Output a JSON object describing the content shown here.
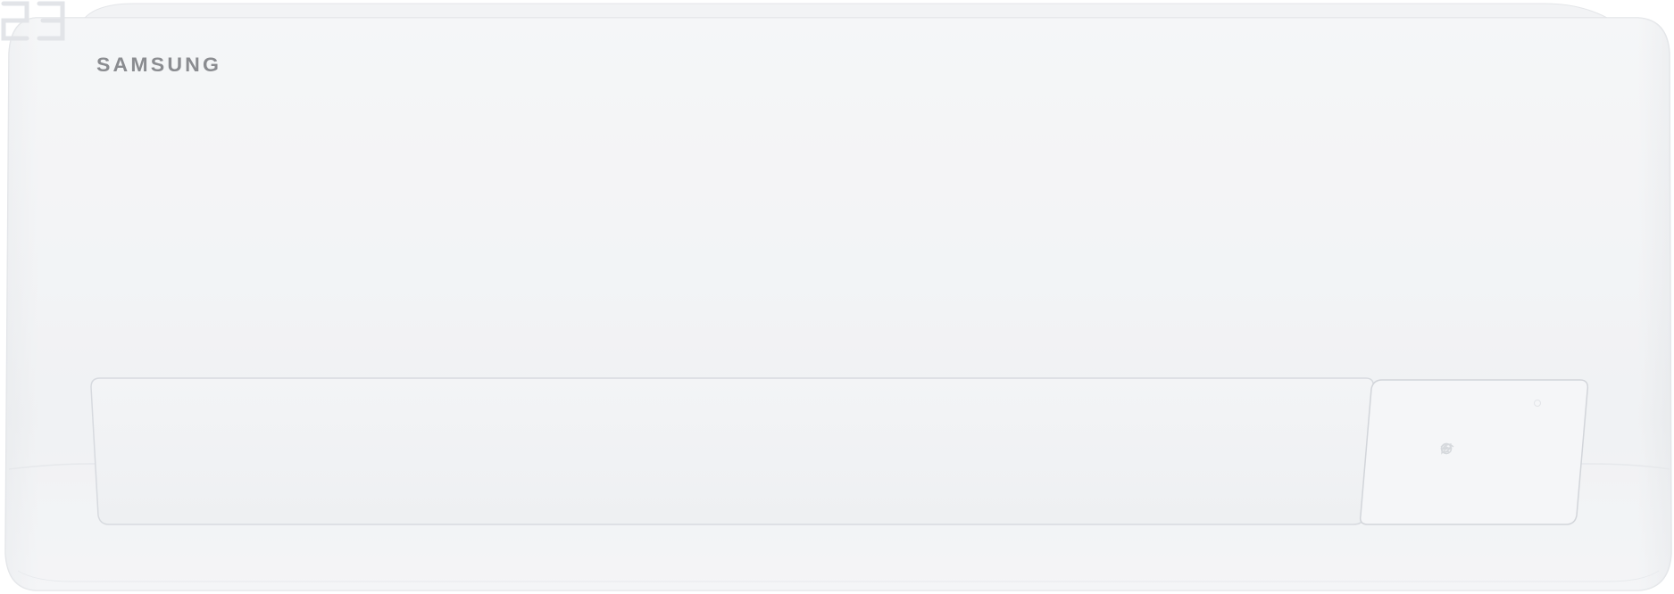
{
  "product": {
    "brand": "SAMSUNG",
    "type": "wall-mounted air conditioner indoor unit"
  },
  "display": {
    "temperature": "23",
    "unit_symbol": "°",
    "indicators": [
      "eco-icon",
      "fan-icon",
      "timer-icon",
      "wifi-icon"
    ]
  },
  "colors": {
    "body": "#f3f4f6",
    "brand_text": "#8a8c90",
    "display_segments": "#e2e4e8"
  }
}
